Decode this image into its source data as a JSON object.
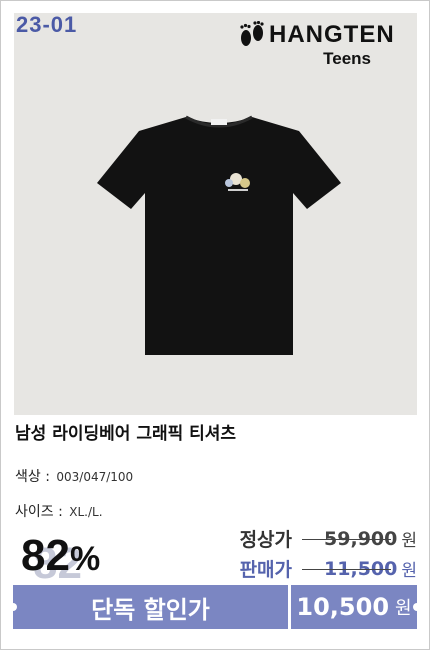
{
  "code": "23-01",
  "brand": {
    "name": "HANGTEN",
    "sub": "Teens",
    "icon": "footprints-icon"
  },
  "product": {
    "title": "남성 라이딩베어 그래픽 티셔츠",
    "color_label": "색상 :",
    "color_value": "003/047/100",
    "size_label": "사이즈 :",
    "size_value": "XL./L."
  },
  "discount": {
    "percent": "82",
    "unit": "%"
  },
  "prices": {
    "regular_label": "정상가",
    "regular_value": "59,900",
    "sale_label": "판매가",
    "sale_value": "11,500",
    "currency": "원"
  },
  "exclusive": {
    "label": "단독 할인가",
    "price": "10,500",
    "currency": "원"
  },
  "colors": {
    "accent": "#7b86c2",
    "code": "#4b5aa6",
    "sale": "#5563ad",
    "shirt": "#121212"
  }
}
